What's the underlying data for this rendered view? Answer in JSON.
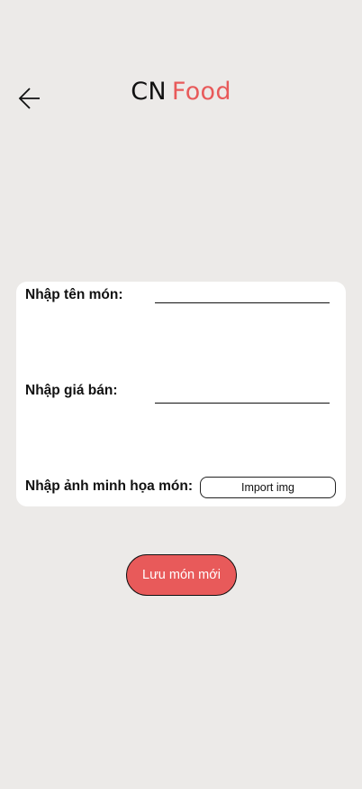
{
  "header": {
    "back_icon": "arrow-left-icon",
    "brand_part1": "CN",
    "brand_part2": "Food",
    "accent_color": "#E85A5A"
  },
  "form": {
    "name_label": "Nhập tên món:",
    "name_value": "",
    "price_label": "Nhập giá bán:",
    "price_value": "",
    "image_label": "Nhập ảnh minh họa món:",
    "import_button_label": "Import img"
  },
  "actions": {
    "save_label": "Lưu món mới"
  },
  "colors": {
    "background": "#ECEAE8",
    "card": "#FFFFFF",
    "accent": "#E85A5A"
  }
}
